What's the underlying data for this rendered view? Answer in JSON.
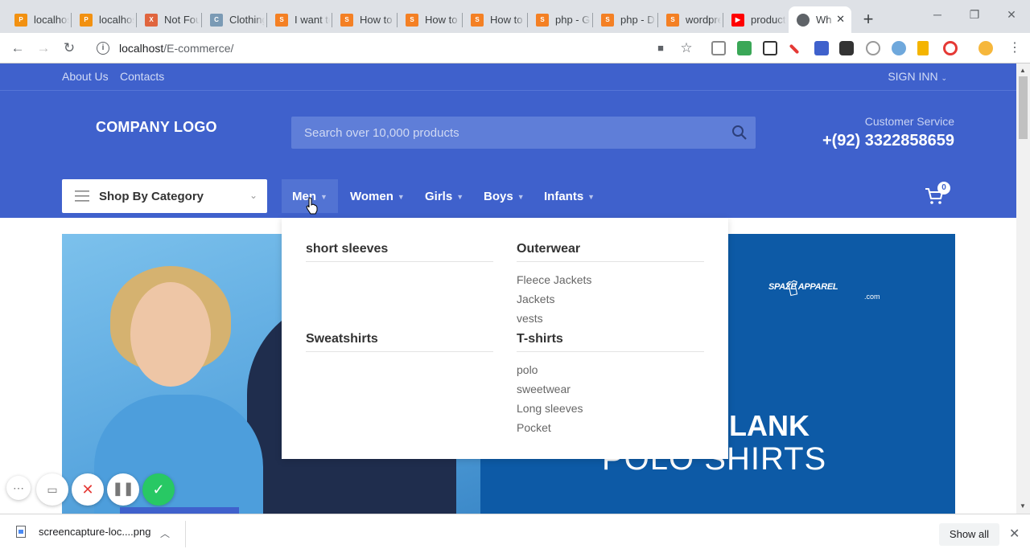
{
  "browser": {
    "tabs": [
      {
        "title": "localhost"
      },
      {
        "title": "localhost"
      },
      {
        "title": "Not Found"
      },
      {
        "title": "Clothing"
      },
      {
        "title": "I want to"
      },
      {
        "title": "How to"
      },
      {
        "title": "How to"
      },
      {
        "title": "How to"
      },
      {
        "title": "php - G"
      },
      {
        "title": "php - D"
      },
      {
        "title": "wordpress"
      },
      {
        "title": "product"
      },
      {
        "title": "Wh"
      }
    ],
    "url_host": "localhost",
    "url_path": "/E-commerce/"
  },
  "site": {
    "top_links": [
      "About Us",
      "Contacts"
    ],
    "sign_in": "SIGN INN",
    "logo": "COMPANY LOGO",
    "search_placeholder": "Search over 10,000 products",
    "customer_service_label": "Customer Service",
    "phone": "+(92) 3322858659",
    "category_label": "Shop By Category",
    "nav": [
      "Men",
      "Women",
      "Girls",
      "Boys",
      "Infants"
    ],
    "cart_count": "0"
  },
  "mega_menu": {
    "col1": [
      {
        "heading": "short sleeves",
        "links": []
      },
      {
        "heading": "Sweatshirts",
        "links": []
      }
    ],
    "col2": [
      {
        "heading": "Outerwear",
        "links": [
          "Fleece Jackets",
          "Jackets",
          "vests"
        ]
      },
      {
        "heading": "T-shirts",
        "links": [
          "polo",
          "sweetwear",
          "Long sleeves",
          "Pocket"
        ]
      }
    ]
  },
  "hero": {
    "brand": "SPAZE APPAREL",
    "brand_sub": ".com",
    "title_line1": "BLANK",
    "title_line2": "POLO SHIRTS"
  },
  "download": {
    "filename": "screencapture-loc....png",
    "show_all": "Show all"
  }
}
